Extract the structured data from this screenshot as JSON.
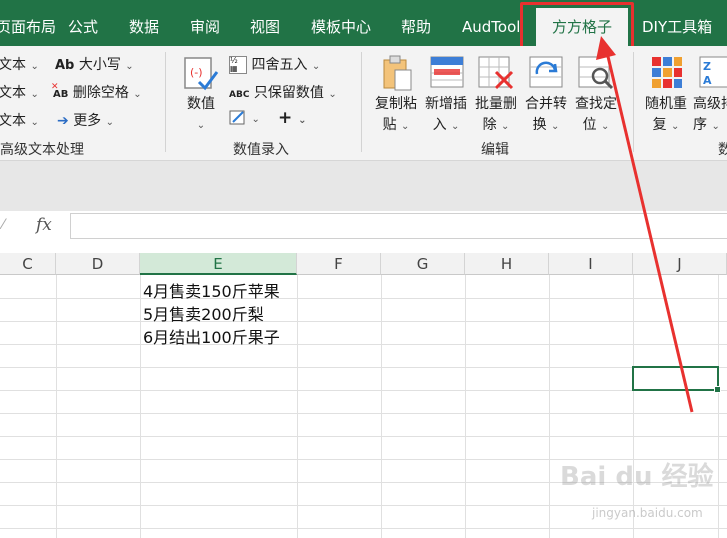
{
  "tabs": [
    {
      "label": "页面布局"
    },
    {
      "label": "公式"
    },
    {
      "label": "数据"
    },
    {
      "label": "审阅"
    },
    {
      "label": "视图"
    },
    {
      "label": "模板中心"
    },
    {
      "label": "帮助"
    },
    {
      "label": "AudTool"
    },
    {
      "label": "方方格子",
      "active": true
    },
    {
      "label": "DIY工具箱"
    }
  ],
  "ribbon": {
    "text_group": {
      "row1_left": "文本",
      "row2_left": "文本",
      "row3_left": "文本",
      "case_btn": "大小写",
      "case_icon": "Ab",
      "del_space_btn": "删除空格",
      "del_space_icon": "AB",
      "more_btn": "更多",
      "label": "高级文本处理"
    },
    "number_group": {
      "value_btn": "数值",
      "round_btn": "四舍五入",
      "keep_num_btn": "只保留数值",
      "keep_num_icon": "ABC",
      "plus_btn": "+",
      "label": "数值录入"
    },
    "edit_group": {
      "copy_paste": [
        "复制粘",
        "贴"
      ],
      "insert_new": [
        "新增插",
        "入"
      ],
      "batch_delete": [
        "批量删",
        "除"
      ],
      "merge_convert": [
        "合并转",
        "换"
      ],
      "find_locate": [
        "查找定",
        "位"
      ],
      "label": "编辑"
    },
    "right_group": {
      "random_dup": [
        "随机重",
        "复"
      ],
      "advanced_sort": [
        "高级排",
        "序"
      ],
      "label_partial": "数"
    }
  },
  "formula_bar": {
    "fx": "fx",
    "content": ""
  },
  "sheet": {
    "columns": [
      "C",
      "D",
      "E",
      "F",
      "G",
      "H",
      "I",
      "J"
    ],
    "selected_column": "E",
    "cells": [
      {
        "col": "E",
        "text": "4月售卖150斤苹果"
      },
      {
        "col": "E",
        "text": "5月售卖200斤梨"
      },
      {
        "col": "E",
        "text": "6月结出100斤果子"
      }
    ]
  },
  "watermark": {
    "logo": "Bai du 经验",
    "url": "jingyan.baidu.com"
  },
  "colors": {
    "excel_green": "#217346",
    "highlight_red": "#e8312f"
  }
}
